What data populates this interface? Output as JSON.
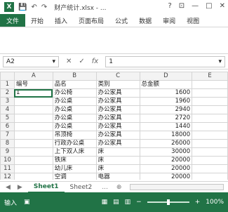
{
  "title": {
    "text": "财产统计.xlsx - ...",
    "help": "?",
    "ribbon_opts": "⊡",
    "min": "—",
    "max": "□",
    "close": "✕"
  },
  "quick_access": {
    "save": "💾",
    "undo": "↶",
    "redo": "↷"
  },
  "ribbon": {
    "file": "文件",
    "tabs": [
      "开始",
      "插入",
      "页面布局",
      "公式",
      "数据",
      "审阅",
      "视图"
    ]
  },
  "formula_bar": {
    "name_box": "A2",
    "cancel": "✕",
    "enter": "✓",
    "fx": "fx",
    "value": "1"
  },
  "grid": {
    "columns": [
      "",
      "A",
      "B",
      "C",
      "D",
      "E"
    ],
    "rows": [
      [
        "1",
        "编号",
        "品名",
        "类别",
        "总金额",
        ""
      ],
      [
        "2",
        "1",
        "办公椅",
        "办公家具",
        "1600",
        ""
      ],
      [
        "3",
        "",
        "办公桌",
        "办公家具",
        "1960",
        ""
      ],
      [
        "4",
        "",
        "办公桌",
        "办公家具",
        "2940",
        ""
      ],
      [
        "5",
        "",
        "办公桌",
        "办公家具",
        "2720",
        ""
      ],
      [
        "6",
        "",
        "办公桌",
        "办公家具",
        "1440",
        ""
      ],
      [
        "7",
        "",
        "吊顶椅",
        "办公家具",
        "18000",
        ""
      ],
      [
        "8",
        "",
        "行政办公桌",
        "办公家具",
        "26000",
        ""
      ],
      [
        "9",
        "",
        "上下双人床",
        "床",
        "30000",
        ""
      ],
      [
        "10",
        "",
        "铁床",
        "床",
        "20000",
        ""
      ],
      [
        "11",
        "",
        "幼儿床",
        "床",
        "20000",
        ""
      ],
      [
        "12",
        "",
        "空调",
        "电器",
        "20000",
        ""
      ],
      [
        "13",
        "",
        "磁性黑板",
        "教学",
        "4200",
        ""
      ],
      [
        "14",
        "",
        "磁性黑板",
        "教学",
        "672",
        ""
      ],
      [
        "15",
        "",
        "电视机",
        "教学",
        "10000",
        ""
      ]
    ]
  },
  "sheets": {
    "nav_prev": "◀",
    "nav_next": "▶",
    "tabs": [
      "Sheet1",
      "Sheet2"
    ],
    "more": "...",
    "add": "⊕"
  },
  "status": {
    "mode": "输入",
    "zoom": "100%"
  }
}
